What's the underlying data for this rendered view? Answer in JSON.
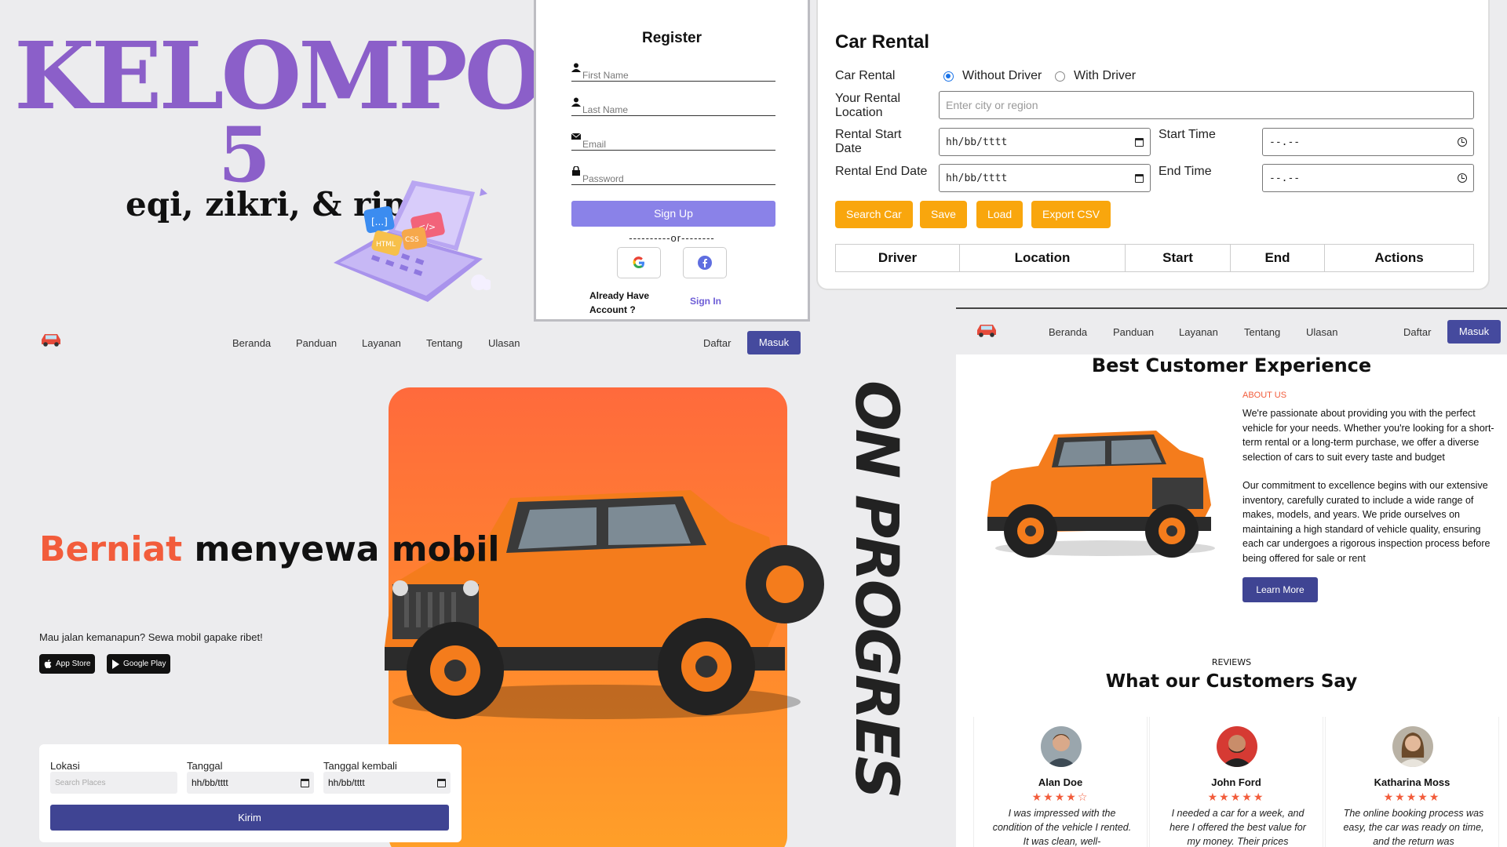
{
  "title_block": {
    "heading": "KELOMPOK",
    "number": "5",
    "members": "eqi, zikri, & ripki"
  },
  "register": {
    "title": "Register",
    "fields": [
      {
        "label": "First Name",
        "icon": "user-icon"
      },
      {
        "label": "Last Name",
        "icon": "user-icon"
      },
      {
        "label": "Email",
        "icon": "envelope-icon"
      },
      {
        "label": "Password",
        "icon": "lock-icon"
      }
    ],
    "signup_label": "Sign Up",
    "or_divider": "----------or--------",
    "social": [
      "google-icon",
      "facebook-icon"
    ],
    "already_text": "Already Have Account ?",
    "signin_label": "Sign In",
    "accent_color": "#8a82e8"
  },
  "rental": {
    "title": "Car Rental",
    "car_rental_label": "Car Rental",
    "option_without": "Without Driver",
    "option_with": "With Driver",
    "location_label": "Your Rental Location",
    "location_placeholder": "Enter city or region",
    "start_date_label": "Rental Start Date",
    "start_date_value": "hh/bb/tttt",
    "start_time_label": "Start Time",
    "start_time_value": "--.--",
    "end_date_label": "Rental End Date",
    "end_date_value": "hh/bb/tttt",
    "end_time_label": "End Time",
    "end_time_value": "--.--",
    "buttons": [
      "Search Car",
      "Save",
      "Load",
      "Export CSV"
    ],
    "table_headers": [
      "Driver",
      "Location",
      "Start",
      "End",
      "Actions"
    ],
    "button_color": "#f9a60d"
  },
  "landing": {
    "nav": [
      "Beranda",
      "Panduan",
      "Layanan",
      "Tentang",
      "Ulasan"
    ],
    "daftar": "Daftar",
    "masuk": "Masuk",
    "hero_accent": "Berniat",
    "hero_rest": "menyewa mobil",
    "hero_sub": "Mau jalan kemanapun? Sewa mobil gapake ribet!",
    "app_store": "App Store",
    "google_play": "Google Play",
    "on_progres": "ON PROGRES",
    "search": {
      "lokasi_label": "Lokasi",
      "lokasi_placeholder": "Search Places",
      "tanggal_label": "Tanggal",
      "tanggal_value": "hh/bb/tttt",
      "kembali_label": "Tanggal kembali",
      "kembali_value": "hh/bb/tttt",
      "kirim_label": "Kirim"
    },
    "accent_color": "#f25c3b",
    "primary_color": "#454a9e"
  },
  "about": {
    "nav": [
      "Beranda",
      "Panduan",
      "Layanan",
      "Tentang",
      "Ulasan"
    ],
    "daftar": "Daftar",
    "masuk": "Masuk",
    "heading": "Best Customer Experience",
    "about_label": "ABOUT US",
    "para1": "We're passionate about providing you with the perfect vehicle for your needs. Whether you're looking for a short-term rental or a long-term purchase, we offer a diverse selection of cars to suit every taste and budget",
    "para2": "Our commitment to excellence begins with our extensive inventory, carefully curated to include a wide range of makes, models, and years. We pride ourselves on maintaining a high standard of vehicle quality, ensuring each car undergoes a rigorous inspection process before being offered for sale or rent",
    "learn_more": "Learn More",
    "reviews_label": "REVIEWS",
    "reviews_heading": "What our Customers Say",
    "reviews": [
      {
        "name": "Alan Doe",
        "stars": "★★★★☆",
        "rating": 4.5,
        "text": "I was impressed with the condition of the vehicle I rented. It was clean, well-"
      },
      {
        "name": "John Ford",
        "stars": "★★★★★",
        "rating": 5,
        "text": "I needed a car for a week, and here I offered the best value for my money. Their prices"
      },
      {
        "name": "Katharina Moss",
        "stars": "★★★★★",
        "rating": 5,
        "text": "The online booking process was easy, the car was ready on time, and the return was"
      }
    ]
  }
}
